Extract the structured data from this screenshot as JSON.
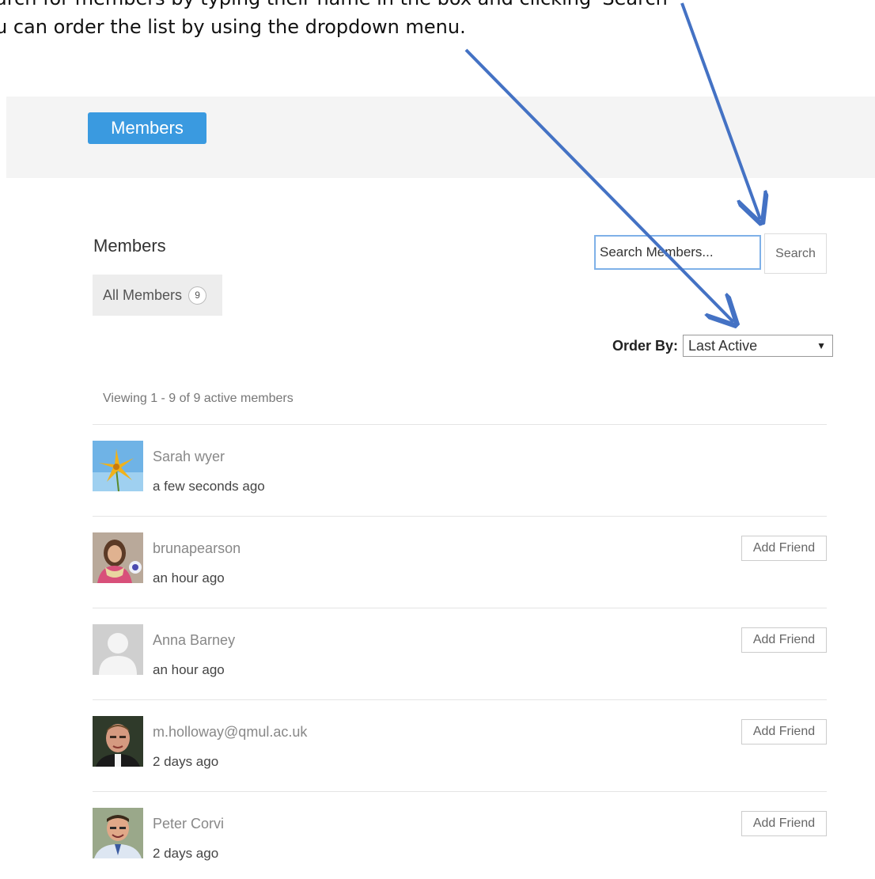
{
  "instructions": {
    "line1": "arch for members by typing their name in the box and clicking 'Search'",
    "line2": "u can order the list by using the dropdown menu."
  },
  "banner": {
    "title": "Members"
  },
  "page": {
    "heading": "Members"
  },
  "tabs": {
    "all_members_label": "All Members",
    "all_members_count": "9"
  },
  "search": {
    "placeholder": "Search Members...",
    "button_label": "Search"
  },
  "order": {
    "label": "Order By:",
    "selected": "Last Active"
  },
  "viewing_text": "Viewing 1 - 9 of 9 active members",
  "members": [
    {
      "name": "Sarah wyer",
      "last_active": "a few seconds ago",
      "avatar": "flower-avatar"
    },
    {
      "name": "brunapearson",
      "last_active": "an hour ago",
      "avatar": "photo-avatar",
      "action": "Add Friend"
    },
    {
      "name": "Anna Barney",
      "last_active": "an hour ago",
      "avatar": "default-user-avatar",
      "action": "Add Friend"
    },
    {
      "name": "m.holloway@qmul.ac.uk",
      "last_active": "2 days ago",
      "avatar": "photo-avatar",
      "action": "Add Friend"
    },
    {
      "name": "Peter Corvi",
      "last_active": "2 days ago",
      "avatar": "photo-avatar",
      "action": "Add Friend"
    }
  ],
  "colors": {
    "accent": "#3a9ae0",
    "arrow": "#4472c4",
    "banner_bg": "#f4f4f4"
  }
}
